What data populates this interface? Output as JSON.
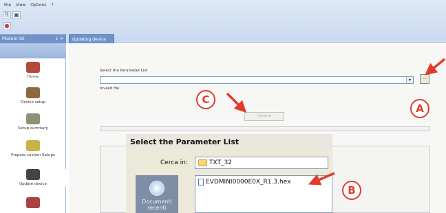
{
  "menu": [
    "File",
    "View",
    "Options",
    "?"
  ],
  "sidebar": {
    "title": "Module list",
    "pin": "↓ ✕",
    "items": [
      {
        "label": "Home",
        "icon": "home-icon",
        "color": "#b44a3a"
      },
      {
        "label": "Device setup",
        "icon": "device-setup-icon",
        "color": "#8a6a3a"
      },
      {
        "label": "Setup summary",
        "icon": "setup-summary-icon",
        "color": "#8f8f7a"
      },
      {
        "label": "Prepare custom Setups",
        "icon": "prepare-custom-setups-icon",
        "color": "#c8b24a"
      },
      {
        "label": "Update device",
        "icon": "update-device-icon",
        "color": "#444"
      },
      {
        "label": "",
        "icon": "tools-icon",
        "color": "#a44"
      }
    ]
  },
  "tab": {
    "label": "Updating device"
  },
  "main": {
    "param_label": "Select the Parameter List",
    "combo_value": "",
    "combo_arrow": "▾",
    "browse": "...",
    "invalid": "Invalid file",
    "update_button": "Update"
  },
  "dialog": {
    "title": "Select the Parameter List",
    "look_in_label": "Cerca in:",
    "look_in_value": "TXT_32",
    "places_label": "Documenti recenti",
    "file": "EVDMINI0000E0X_R1.3.hex"
  },
  "callouts": {
    "a": "A",
    "b": "B",
    "c": "C",
    "color": "#e23b2c"
  }
}
